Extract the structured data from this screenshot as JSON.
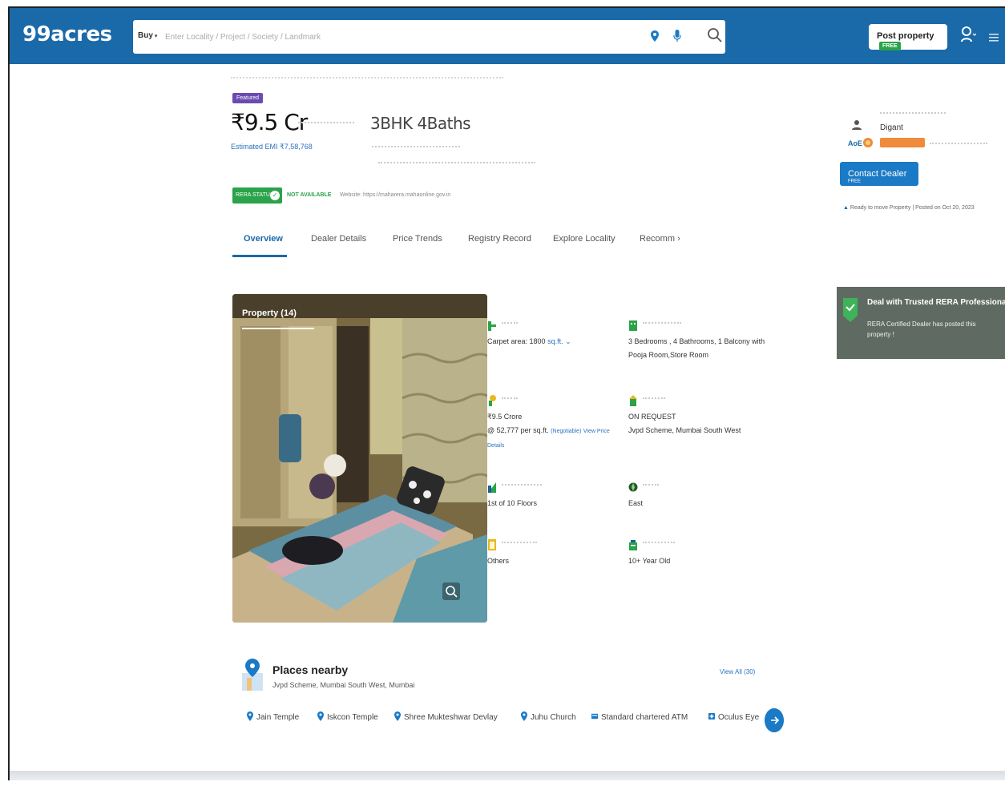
{
  "header": {
    "logo": "99acres",
    "search_mode": "Buy",
    "search_placeholder": "Enter Locality / Project / Society / Landmark",
    "post_property_label": "Post property",
    "post_property_badge": "FREE"
  },
  "summary": {
    "featured_badge": "Featured",
    "price": "₹9.5 Cr",
    "config": "3BHK 4Baths",
    "emi": "Estimated EMI ₹7,58,768",
    "rera_status": "RERA STATUS",
    "rera_value": "NOT AVAILABLE",
    "rera_website": "Website: https://maharera.mahaonline.gov.in"
  },
  "dealer": {
    "name": "Digant",
    "contact_label": "Contact Dealer",
    "contact_badge": "FREE",
    "ready_line": "Ready to move Property  |  Posted on Oct 20, 2023"
  },
  "tabs": [
    {
      "label": "Overview",
      "active": true
    },
    {
      "label": "Dealer Details",
      "active": false
    },
    {
      "label": "Price Trends",
      "active": false
    },
    {
      "label": "Registry Record",
      "active": false
    },
    {
      "label": "Explore Locality",
      "active": false
    },
    {
      "label": "Recomm",
      "active": false
    }
  ],
  "rera_banner": {
    "title": "Deal with Trusted RERA Professionals",
    "desc": "RERA Certified Dealer has posted this property !"
  },
  "photo": {
    "label": "Property (14)"
  },
  "details": {
    "area_value": "Carpet area: 1800",
    "area_unit": "sq.ft.",
    "config_value_1": "3 Bedrooms , 4 Bathrooms, 1 Balcony with",
    "config_value_2": "Pooja Room,Store Room",
    "price_value_1": "₹9.5 Crore",
    "price_value_2": "@ 52,777 per sq.ft.",
    "price_negotiable": "(Negotiable)",
    "price_view": "View Price",
    "price_details": "Details",
    "address_value_1": "ON REQUEST",
    "address_value_2": "Jvpd Scheme, Mumbai South West",
    "floor_value": "1st of 10 Floors",
    "facing_value": "East",
    "ownership_value": "Others",
    "age_value": "10+ Year Old"
  },
  "places": {
    "title": "Places nearby",
    "subtitle": "Jvpd Scheme, Mumbai South West, Mumbai",
    "view_all": "View All (30)",
    "chips": [
      "Jain Temple",
      "Iskcon Temple",
      "Shree Mukteshwar Devlay",
      "Juhu Church",
      "Standard chartered ATM",
      "Oculus Eye"
    ]
  },
  "colors": {
    "brand": "#1a69a8",
    "accent_link": "#2a73c0",
    "rera_green": "#2aa34a",
    "featured_purple": "#6b4bb0",
    "banner_grey": "#5f6b62"
  }
}
